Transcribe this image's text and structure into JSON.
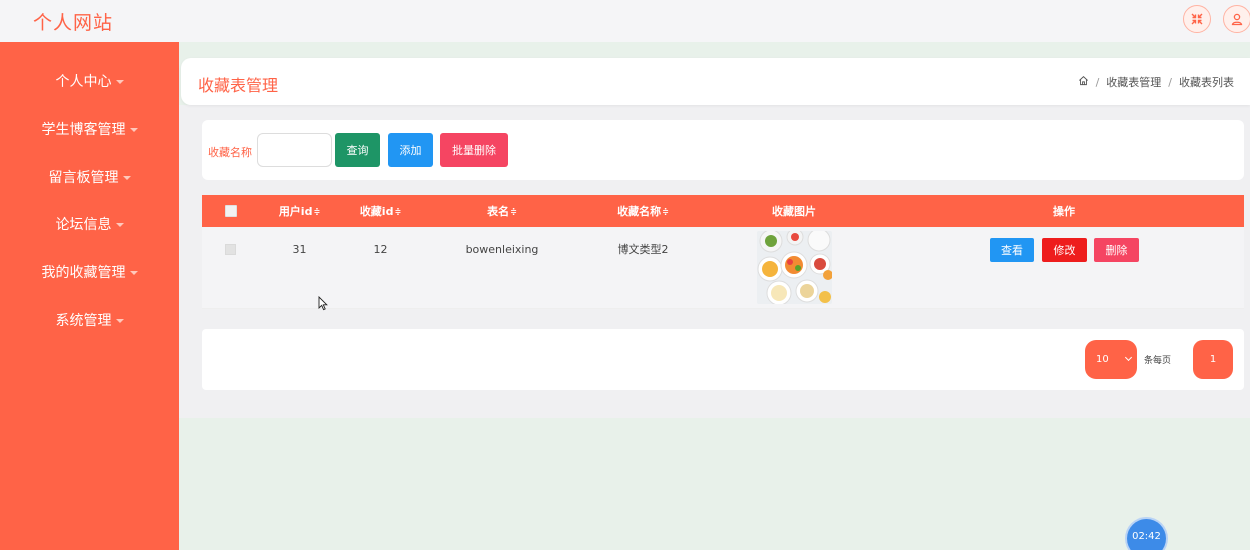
{
  "app": {
    "title": "个人网站"
  },
  "header": {
    "fullscreen_icon": "fullscreen-exit-icon",
    "user_icon": "user-icon"
  },
  "sidebar": {
    "items": [
      {
        "label": "个人中心"
      },
      {
        "label": "学生博客管理"
      },
      {
        "label": "留言板管理"
      },
      {
        "label": "论坛信息"
      },
      {
        "label": "我的收藏管理"
      },
      {
        "label": "系统管理"
      }
    ]
  },
  "page": {
    "title": "收藏表管理",
    "breadcrumb": [
      "收藏表管理",
      "收藏表列表"
    ]
  },
  "search": {
    "label": "收藏名称",
    "value": "",
    "query_label": "查询",
    "add_label": "添加",
    "batch_delete_label": "批量删除"
  },
  "table": {
    "columns": [
      "用户id",
      "收藏id",
      "表名",
      "收藏名称",
      "收藏图片",
      "操作"
    ],
    "sort_icon": "≑",
    "rows": [
      {
        "user_id": "31",
        "collect_id": "12",
        "table_name": "bowenleixing",
        "collect_name": "博文类型2",
        "view_label": "查看",
        "edit_label": "修改",
        "delete_label": "删除"
      }
    ]
  },
  "pagination": {
    "page_size": "10",
    "per_page_text": "条每页",
    "current_page": "1"
  },
  "timer": {
    "text": "02:42"
  },
  "colors": {
    "primary": "#ff6347",
    "query": "#1e9566",
    "add": "#2196f3",
    "danger": "#f54562",
    "edit": "#ee1d1d"
  }
}
